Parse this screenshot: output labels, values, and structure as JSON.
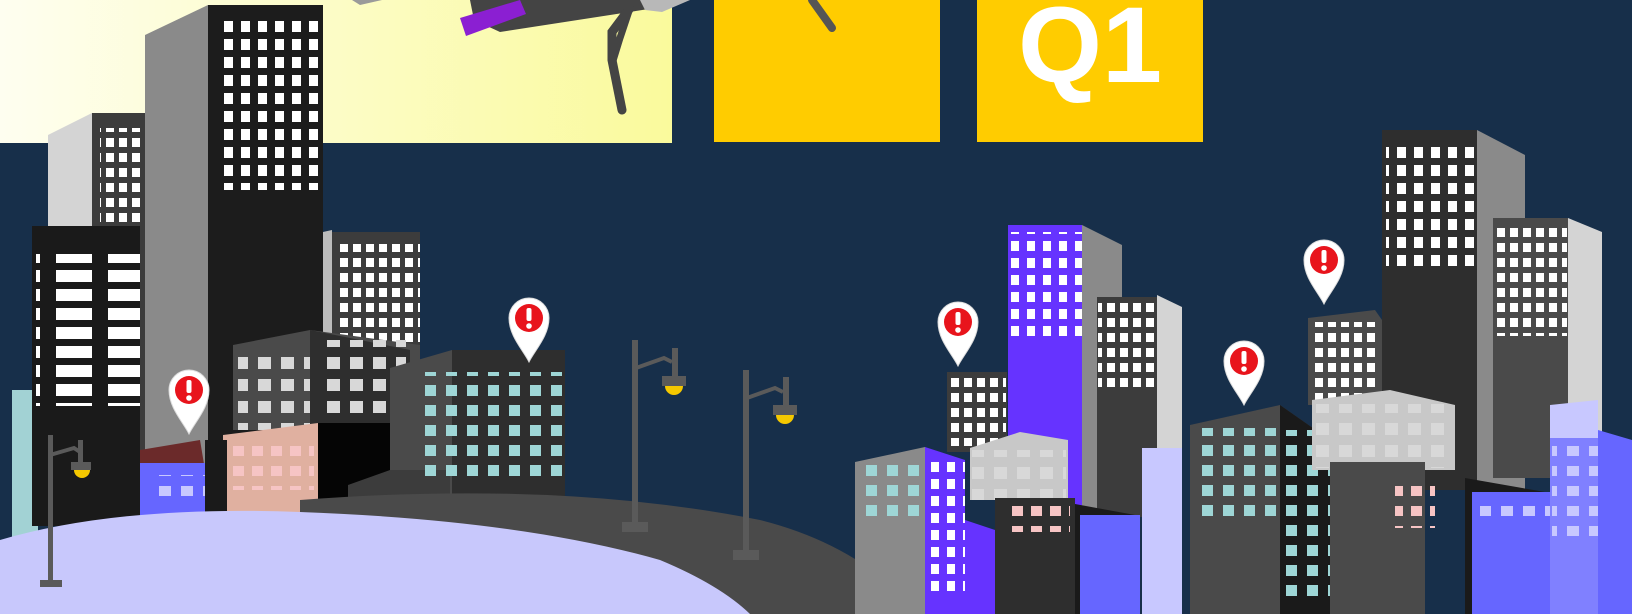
{
  "banner": {
    "quarter_label": "Q1"
  },
  "colors": {
    "night_sky": "#172f4a",
    "panel_yellow": "#ffcc00",
    "sky_glow": "#fafaa0",
    "ground_lavender": "#c8c8fc",
    "ground_dark": "#4a4a4a",
    "alert_red": "#e8141c",
    "lamp_yellow": "#f5c800",
    "purple_building": "#6633ff"
  },
  "icons": [
    "alert-pin-icon",
    "street-lamp-icon",
    "telescope-icon"
  ],
  "alert_pin_count": 5,
  "street_lamp_count": 3
}
